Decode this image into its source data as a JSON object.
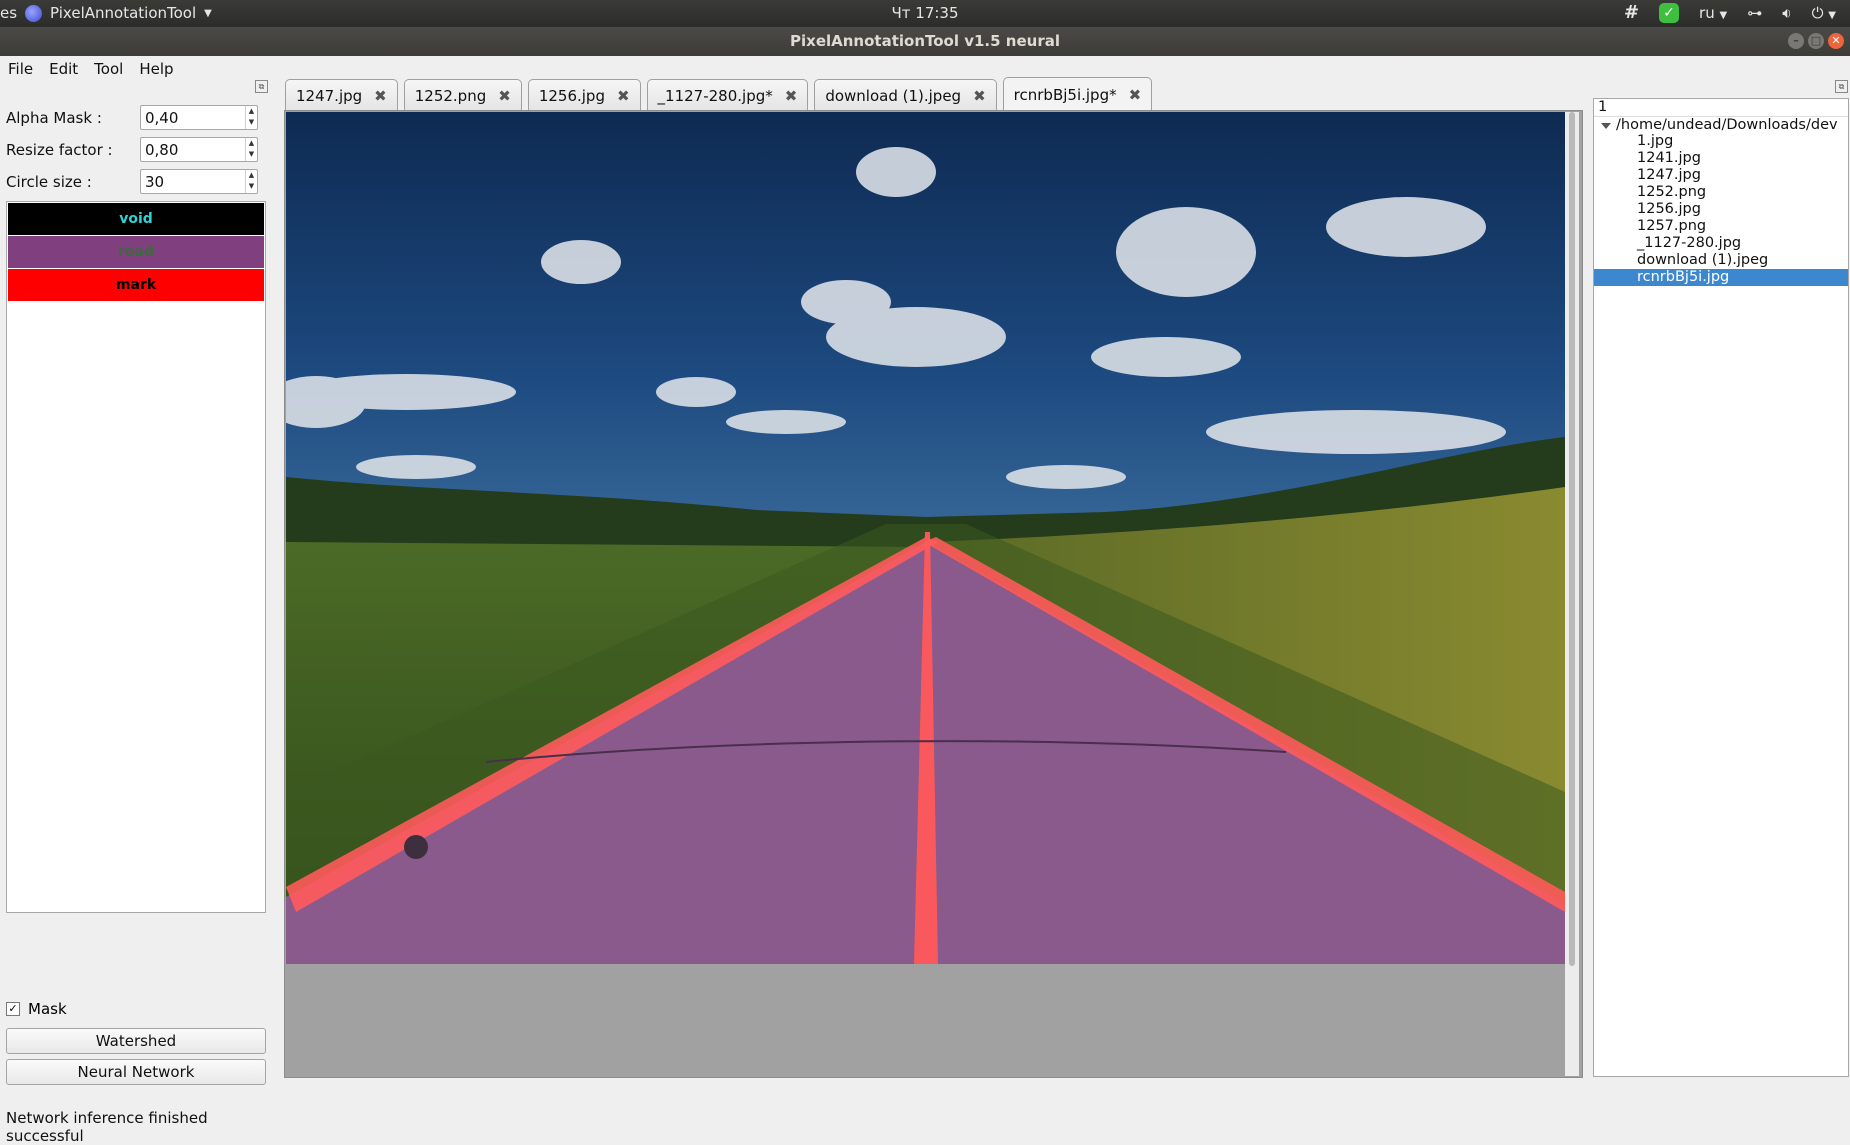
{
  "topbar": {
    "edge_text": "es",
    "app_name": "PixelAnnotationTool",
    "clock": "Чт 17:35",
    "lang": "ru",
    "icons": [
      "slack-icon",
      "check-icon",
      "network-icon",
      "volume-icon",
      "power-icon"
    ]
  },
  "window": {
    "title": "PixelAnnotationTool v1.5 neural"
  },
  "menu": {
    "file": "File",
    "edit": "Edit",
    "tool": "Tool",
    "help": "Help"
  },
  "controls": {
    "alpha_label": "Alpha Mask :",
    "alpha_value": "0,40",
    "resize_label": "Resize factor :",
    "resize_value": "0,80",
    "circle_label": "Circle size :",
    "circle_value": "30"
  },
  "labels": [
    {
      "name": "void",
      "bg": "#000000",
      "fg": "#2fd3d3"
    },
    {
      "name": "road",
      "bg": "#80407f",
      "fg": "#3c6a3c"
    },
    {
      "name": "mark",
      "bg": "#ff0000",
      "fg": "#000000"
    }
  ],
  "mask_checkbox": {
    "label": "Mask",
    "checked": true
  },
  "buttons": {
    "watershed": "Watershed",
    "neural": "Neural Network"
  },
  "status": "Network inference finished successful",
  "tabs": [
    "1247.jpg",
    "1252.png",
    "1256.jpg",
    "_1127-280.jpg*",
    "download (1).jpeg",
    "rcnrbBj5i.jpg*"
  ],
  "active_tab_index": 5,
  "tree": {
    "header": "1",
    "root": "/home/undead/Downloads/dev",
    "files": [
      "1.jpg",
      "1241.jpg",
      "1247.jpg",
      "1252.png",
      "1256.jpg",
      "1257.png",
      "_1127-280.jpg",
      "download (1).jpeg",
      "rcnrbBj5i.jpg"
    ],
    "selected_index": 8
  }
}
